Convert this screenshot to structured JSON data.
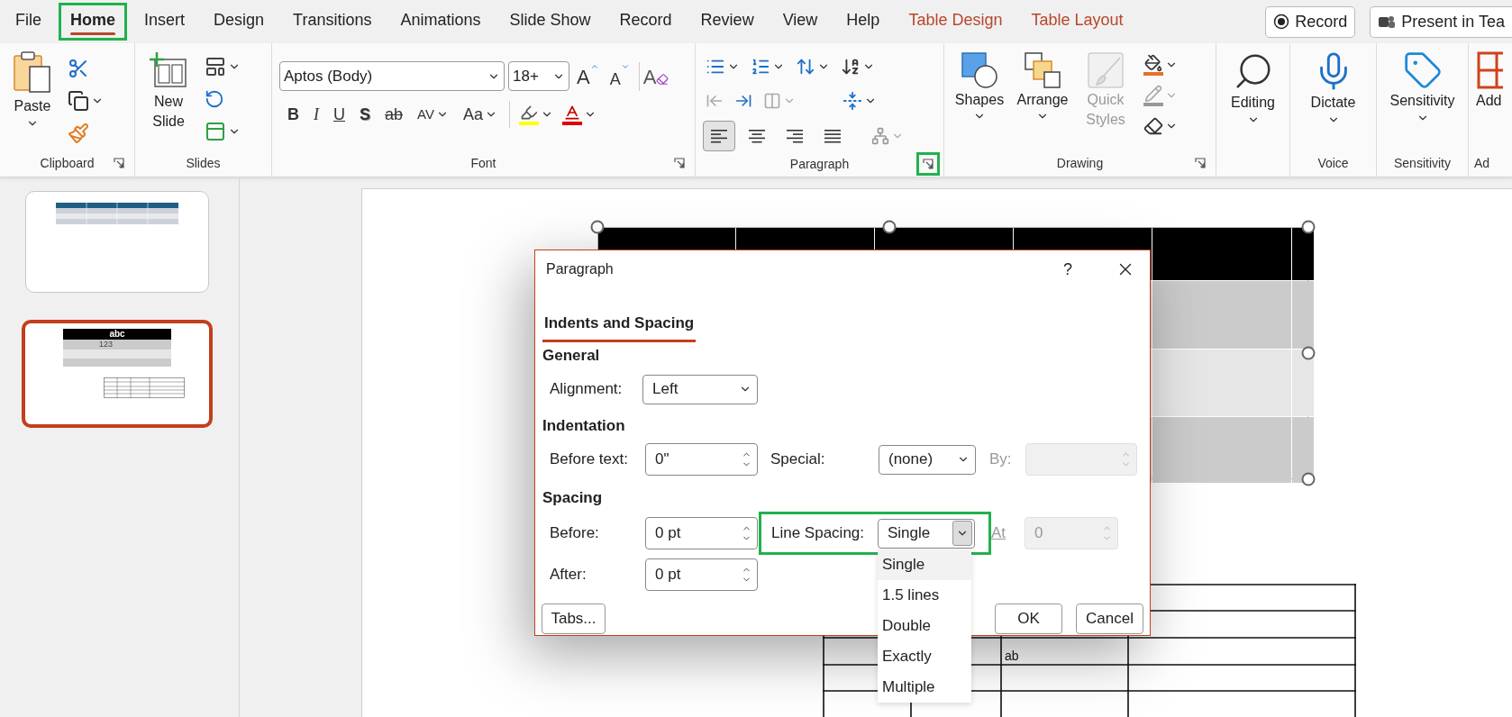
{
  "menu_tabs": [
    {
      "label": "File",
      "selected": false,
      "highlighted": false,
      "kind": "standard"
    },
    {
      "label": "Home",
      "selected": true,
      "highlighted": true,
      "kind": "standard"
    },
    {
      "label": "Insert",
      "selected": false,
      "highlighted": false,
      "kind": "standard"
    },
    {
      "label": "Design",
      "selected": false,
      "highlighted": false,
      "kind": "standard"
    },
    {
      "label": "Transitions",
      "selected": false,
      "highlighted": false,
      "kind": "standard"
    },
    {
      "label": "Animations",
      "selected": false,
      "highlighted": false,
      "kind": "standard"
    },
    {
      "label": "Slide Show",
      "selected": false,
      "highlighted": false,
      "kind": "standard"
    },
    {
      "label": "Record",
      "selected": false,
      "highlighted": false,
      "kind": "standard"
    },
    {
      "label": "Review",
      "selected": false,
      "highlighted": false,
      "kind": "standard"
    },
    {
      "label": "View",
      "selected": false,
      "highlighted": false,
      "kind": "standard"
    },
    {
      "label": "Help",
      "selected": false,
      "highlighted": false,
      "kind": "standard"
    },
    {
      "label": "Table Design",
      "selected": false,
      "highlighted": false,
      "kind": "contextual"
    },
    {
      "label": "Table Layout",
      "selected": false,
      "highlighted": false,
      "kind": "contextual"
    }
  ],
  "header_buttons": [
    {
      "label": "Record",
      "kind": "record"
    },
    {
      "label": "Present in Tea",
      "kind": "teams"
    }
  ],
  "ribbon": {
    "clipboard": {
      "label": "Clipboard",
      "paste": "Paste",
      "launcher_highlighted": false
    },
    "slides": {
      "label": "Slides",
      "new_slide": "New Slide"
    },
    "font": {
      "label": "Font",
      "font_name": "Aptos (Body)",
      "font_size": "18+",
      "launcher_highlighted": false,
      "size_buttons": [
        {
          "glyph": "A",
          "kind": "grow"
        },
        {
          "glyph": "A",
          "kind": "shrink"
        },
        {
          "glyph": "A",
          "kind": "clear"
        }
      ],
      "format": [
        {
          "glyph": "B",
          "kind": "bold"
        },
        {
          "glyph": "I",
          "kind": "italic"
        },
        {
          "glyph": "U",
          "kind": "underline"
        },
        {
          "glyph": "S",
          "kind": "shadow"
        },
        {
          "glyph": "ab",
          "kind": "strike"
        },
        {
          "glyph": "AV",
          "kind": "spacing"
        },
        {
          "glyph": "Aa",
          "kind": "case"
        }
      ]
    },
    "paragraph": {
      "label": "Paragraph",
      "launcher_highlighted": true,
      "align": [
        {
          "kind": "left",
          "selected": true
        },
        {
          "kind": "center",
          "selected": false
        },
        {
          "kind": "right",
          "selected": false
        },
        {
          "kind": "justify",
          "selected": false
        }
      ]
    },
    "drawing": {
      "label": "Drawing",
      "launcher_highlighted": false,
      "buttons": [
        {
          "label": "Shapes",
          "kind": "shapes",
          "disabled": false
        },
        {
          "label": "Arrange",
          "kind": "arrange",
          "disabled": false
        },
        {
          "label": "Quick Styles",
          "kind": "styles",
          "disabled": true
        }
      ]
    },
    "editing": {
      "button": "Editing"
    },
    "voice": {
      "label": "Voice",
      "button": "Dictate"
    },
    "sensitivity": {
      "label": "Sensitivity",
      "button": "Sensitivity"
    },
    "add": {
      "label": "Ad",
      "button": "Add"
    }
  },
  "thumbnails": [
    {
      "selected": false,
      "kind": "blue-table"
    },
    {
      "selected": true,
      "kind": "grey-table",
      "header": "abc",
      "cell": "123"
    }
  ],
  "slide": {
    "lower_table_cell": "ab"
  },
  "dialog": {
    "title": "Paragraph",
    "help": "?",
    "tabs": [
      {
        "label": "Indents and Spacing",
        "selected": true
      }
    ],
    "general": {
      "heading": "General",
      "alignment": {
        "label": "Alignment:",
        "value": "Left"
      }
    },
    "indentation": {
      "heading": "Indentation",
      "before_text": {
        "label": "Before text:",
        "value": "0\""
      },
      "special": {
        "label": "Special:",
        "value": "(none)"
      },
      "by": {
        "label": "By:",
        "disabled": true
      }
    },
    "spacing": {
      "heading": "Spacing",
      "before": {
        "label": "Before:",
        "value": "0 pt"
      },
      "after": {
        "label": "After:",
        "value": "0 pt"
      },
      "line_spacing": {
        "label": "Line Spacing:",
        "value": "Single",
        "highlighted": true,
        "expanded": true,
        "options": [
          {
            "label": "Single",
            "selected": true
          },
          {
            "label": "1.5 lines",
            "selected": false
          },
          {
            "label": "Double",
            "selected": false
          },
          {
            "label": "Exactly",
            "selected": false
          },
          {
            "label": "Multiple",
            "selected": false
          }
        ]
      },
      "at": {
        "label": "At",
        "value": "0",
        "disabled": true
      }
    },
    "buttons": [
      {
        "label": "Tabs...",
        "kind": "tabs"
      },
      {
        "label": "OK",
        "kind": "ok"
      },
      {
        "label": "Cancel",
        "kind": "cancel"
      }
    ]
  }
}
